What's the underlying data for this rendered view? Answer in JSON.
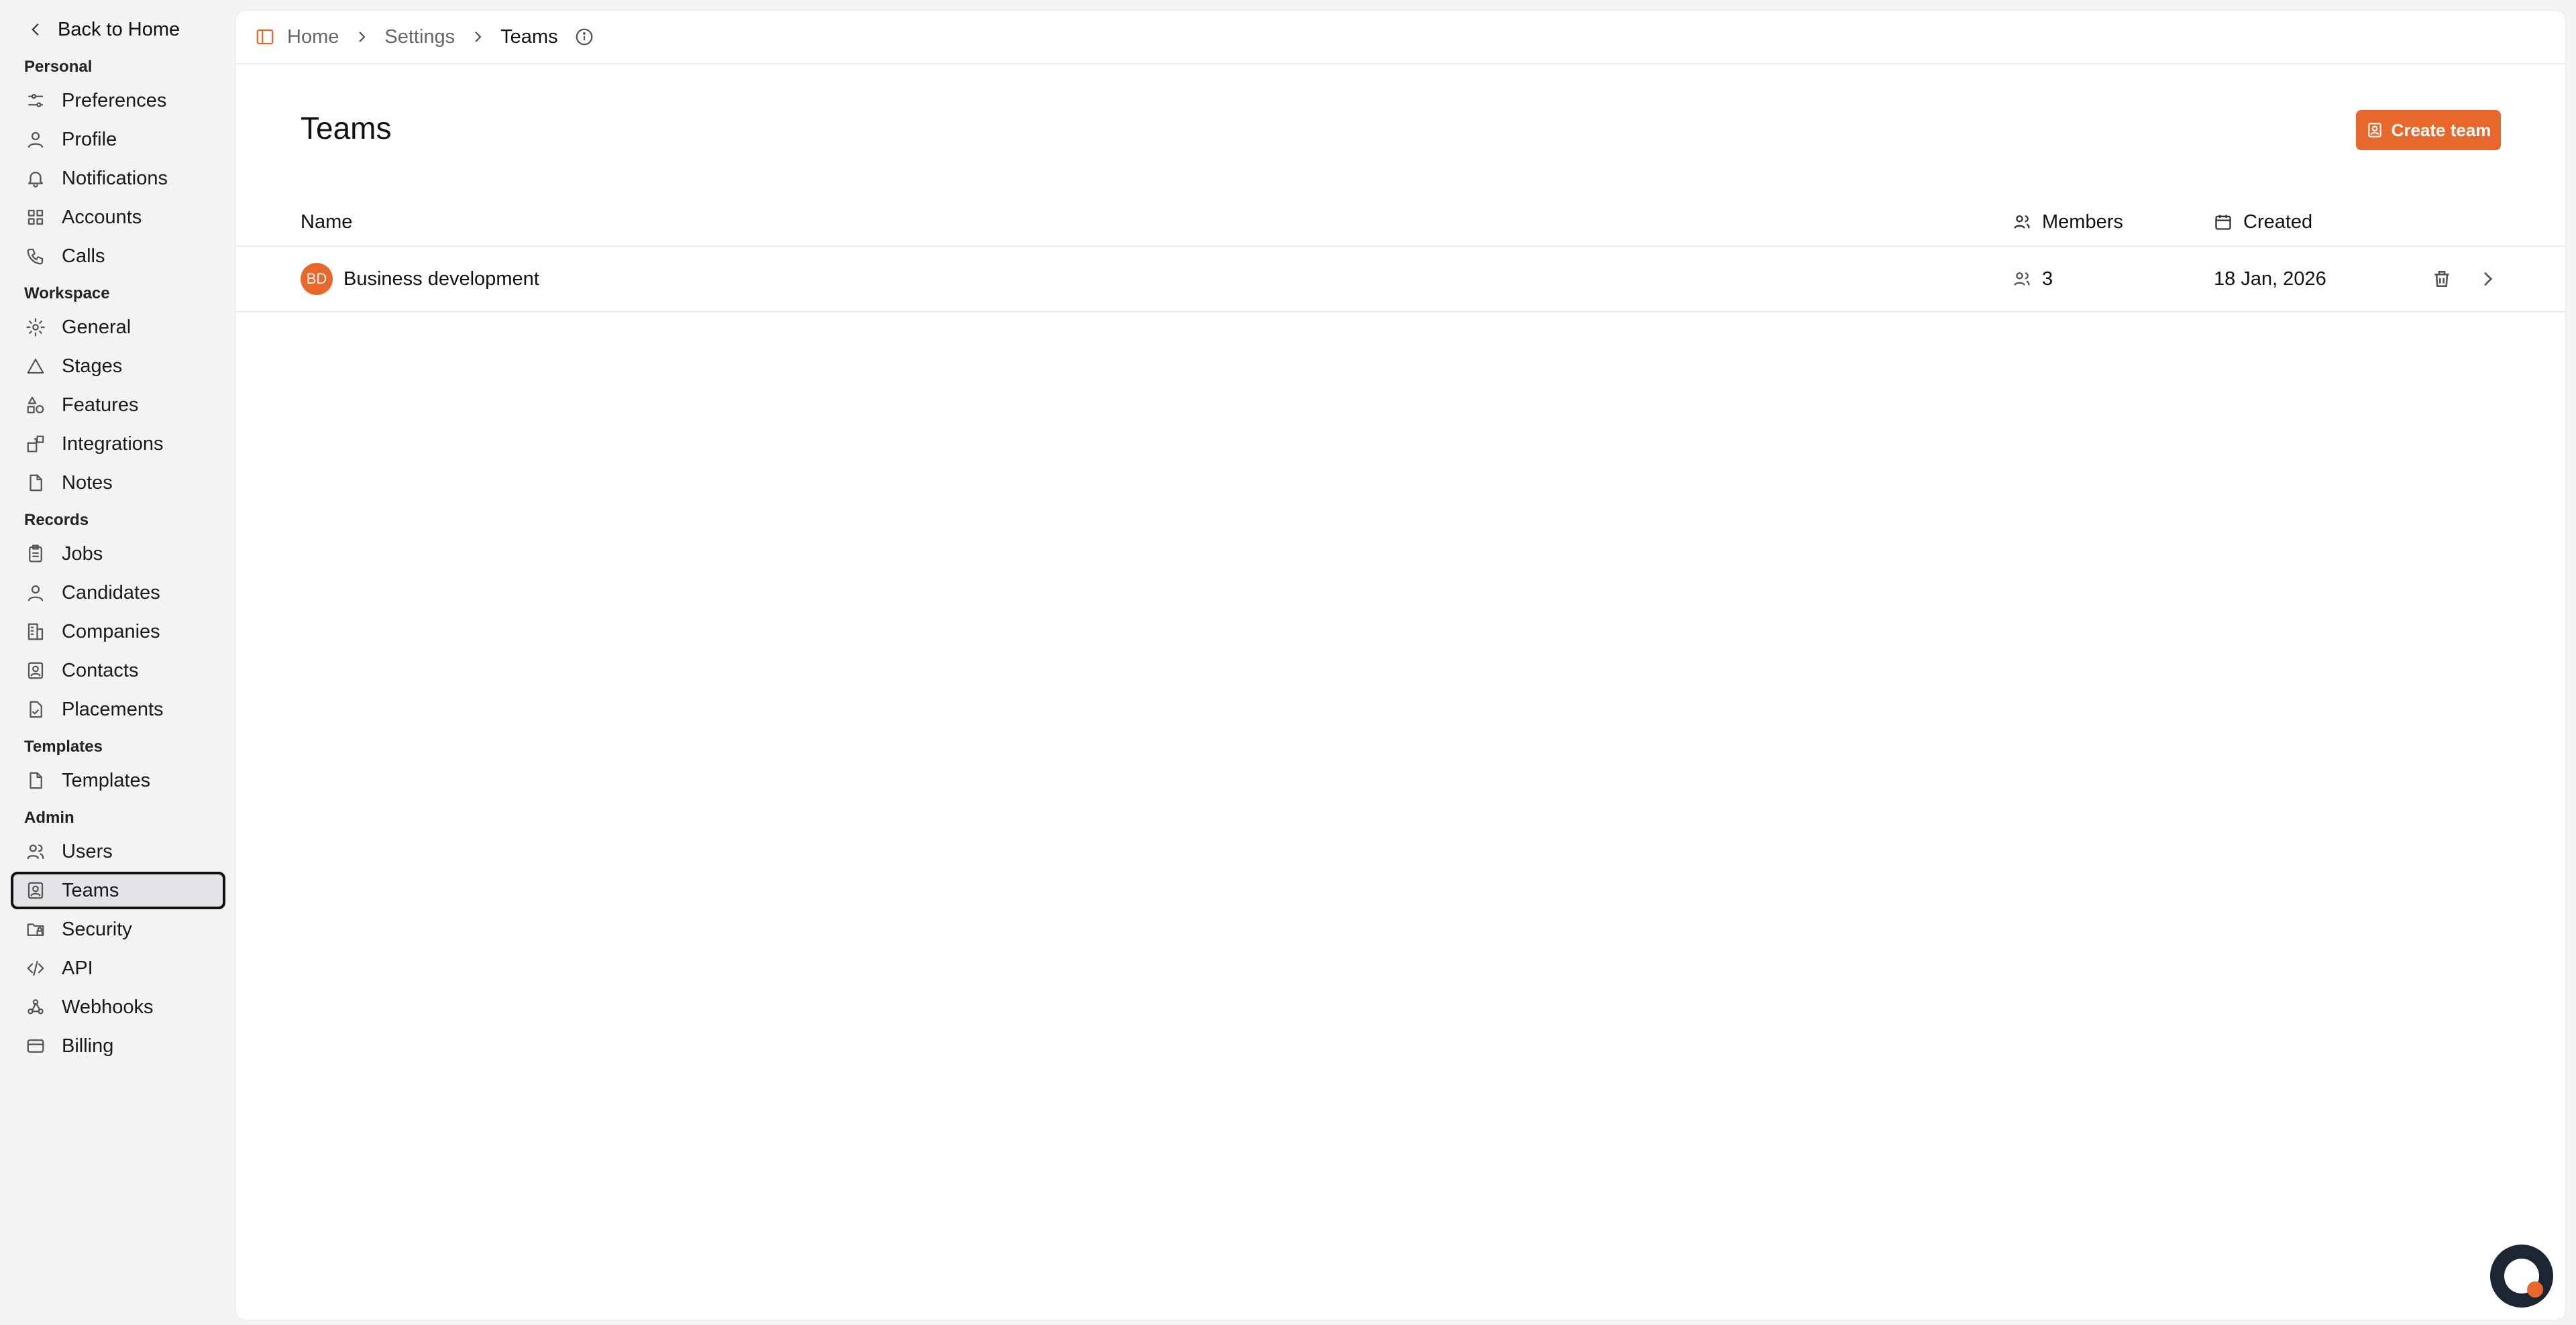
{
  "sidebar": {
    "back_label": "Back to Home",
    "sections": [
      {
        "title": "Personal",
        "items": [
          {
            "label": "Preferences",
            "icon": "sliders-icon"
          },
          {
            "label": "Profile",
            "icon": "user-icon"
          },
          {
            "label": "Notifications",
            "icon": "bell-icon"
          },
          {
            "label": "Accounts",
            "icon": "grid-icon"
          },
          {
            "label": "Calls",
            "icon": "phone-icon"
          }
        ]
      },
      {
        "title": "Workspace",
        "items": [
          {
            "label": "General",
            "icon": "gear-icon"
          },
          {
            "label": "Stages",
            "icon": "triangle-icon"
          },
          {
            "label": "Features",
            "icon": "shapes-icon"
          },
          {
            "label": "Integrations",
            "icon": "blocks-icon"
          },
          {
            "label": "Notes",
            "icon": "file-icon"
          }
        ]
      },
      {
        "title": "Records",
        "items": [
          {
            "label": "Jobs",
            "icon": "clipboard-icon"
          },
          {
            "label": "Candidates",
            "icon": "user-icon"
          },
          {
            "label": "Companies",
            "icon": "building-icon"
          },
          {
            "label": "Contacts",
            "icon": "contact-icon"
          },
          {
            "label": "Placements",
            "icon": "file-check-icon"
          }
        ]
      },
      {
        "title": "Templates",
        "items": [
          {
            "label": "Templates",
            "icon": "file-icon"
          }
        ]
      },
      {
        "title": "Admin",
        "items": [
          {
            "label": "Users",
            "icon": "users-icon"
          },
          {
            "label": "Teams",
            "icon": "contact-icon",
            "active": true
          },
          {
            "label": "Security",
            "icon": "folder-lock-icon"
          },
          {
            "label": "API",
            "icon": "code-icon"
          },
          {
            "label": "Webhooks",
            "icon": "webhook-icon"
          },
          {
            "label": "Billing",
            "icon": "credit-card-icon"
          }
        ]
      }
    ]
  },
  "breadcrumb": {
    "items": [
      "Home",
      "Settings",
      "Teams"
    ]
  },
  "page": {
    "title": "Teams",
    "create_button": "Create team"
  },
  "table": {
    "headers": {
      "name": "Name",
      "members": "Members",
      "created": "Created"
    },
    "rows": [
      {
        "initials": "BD",
        "name": "Business development",
        "members": "3",
        "created": "18 Jan, 2026"
      }
    ]
  },
  "colors": {
    "accent": "#e8672b",
    "active_bg": "#e2e4e7"
  }
}
